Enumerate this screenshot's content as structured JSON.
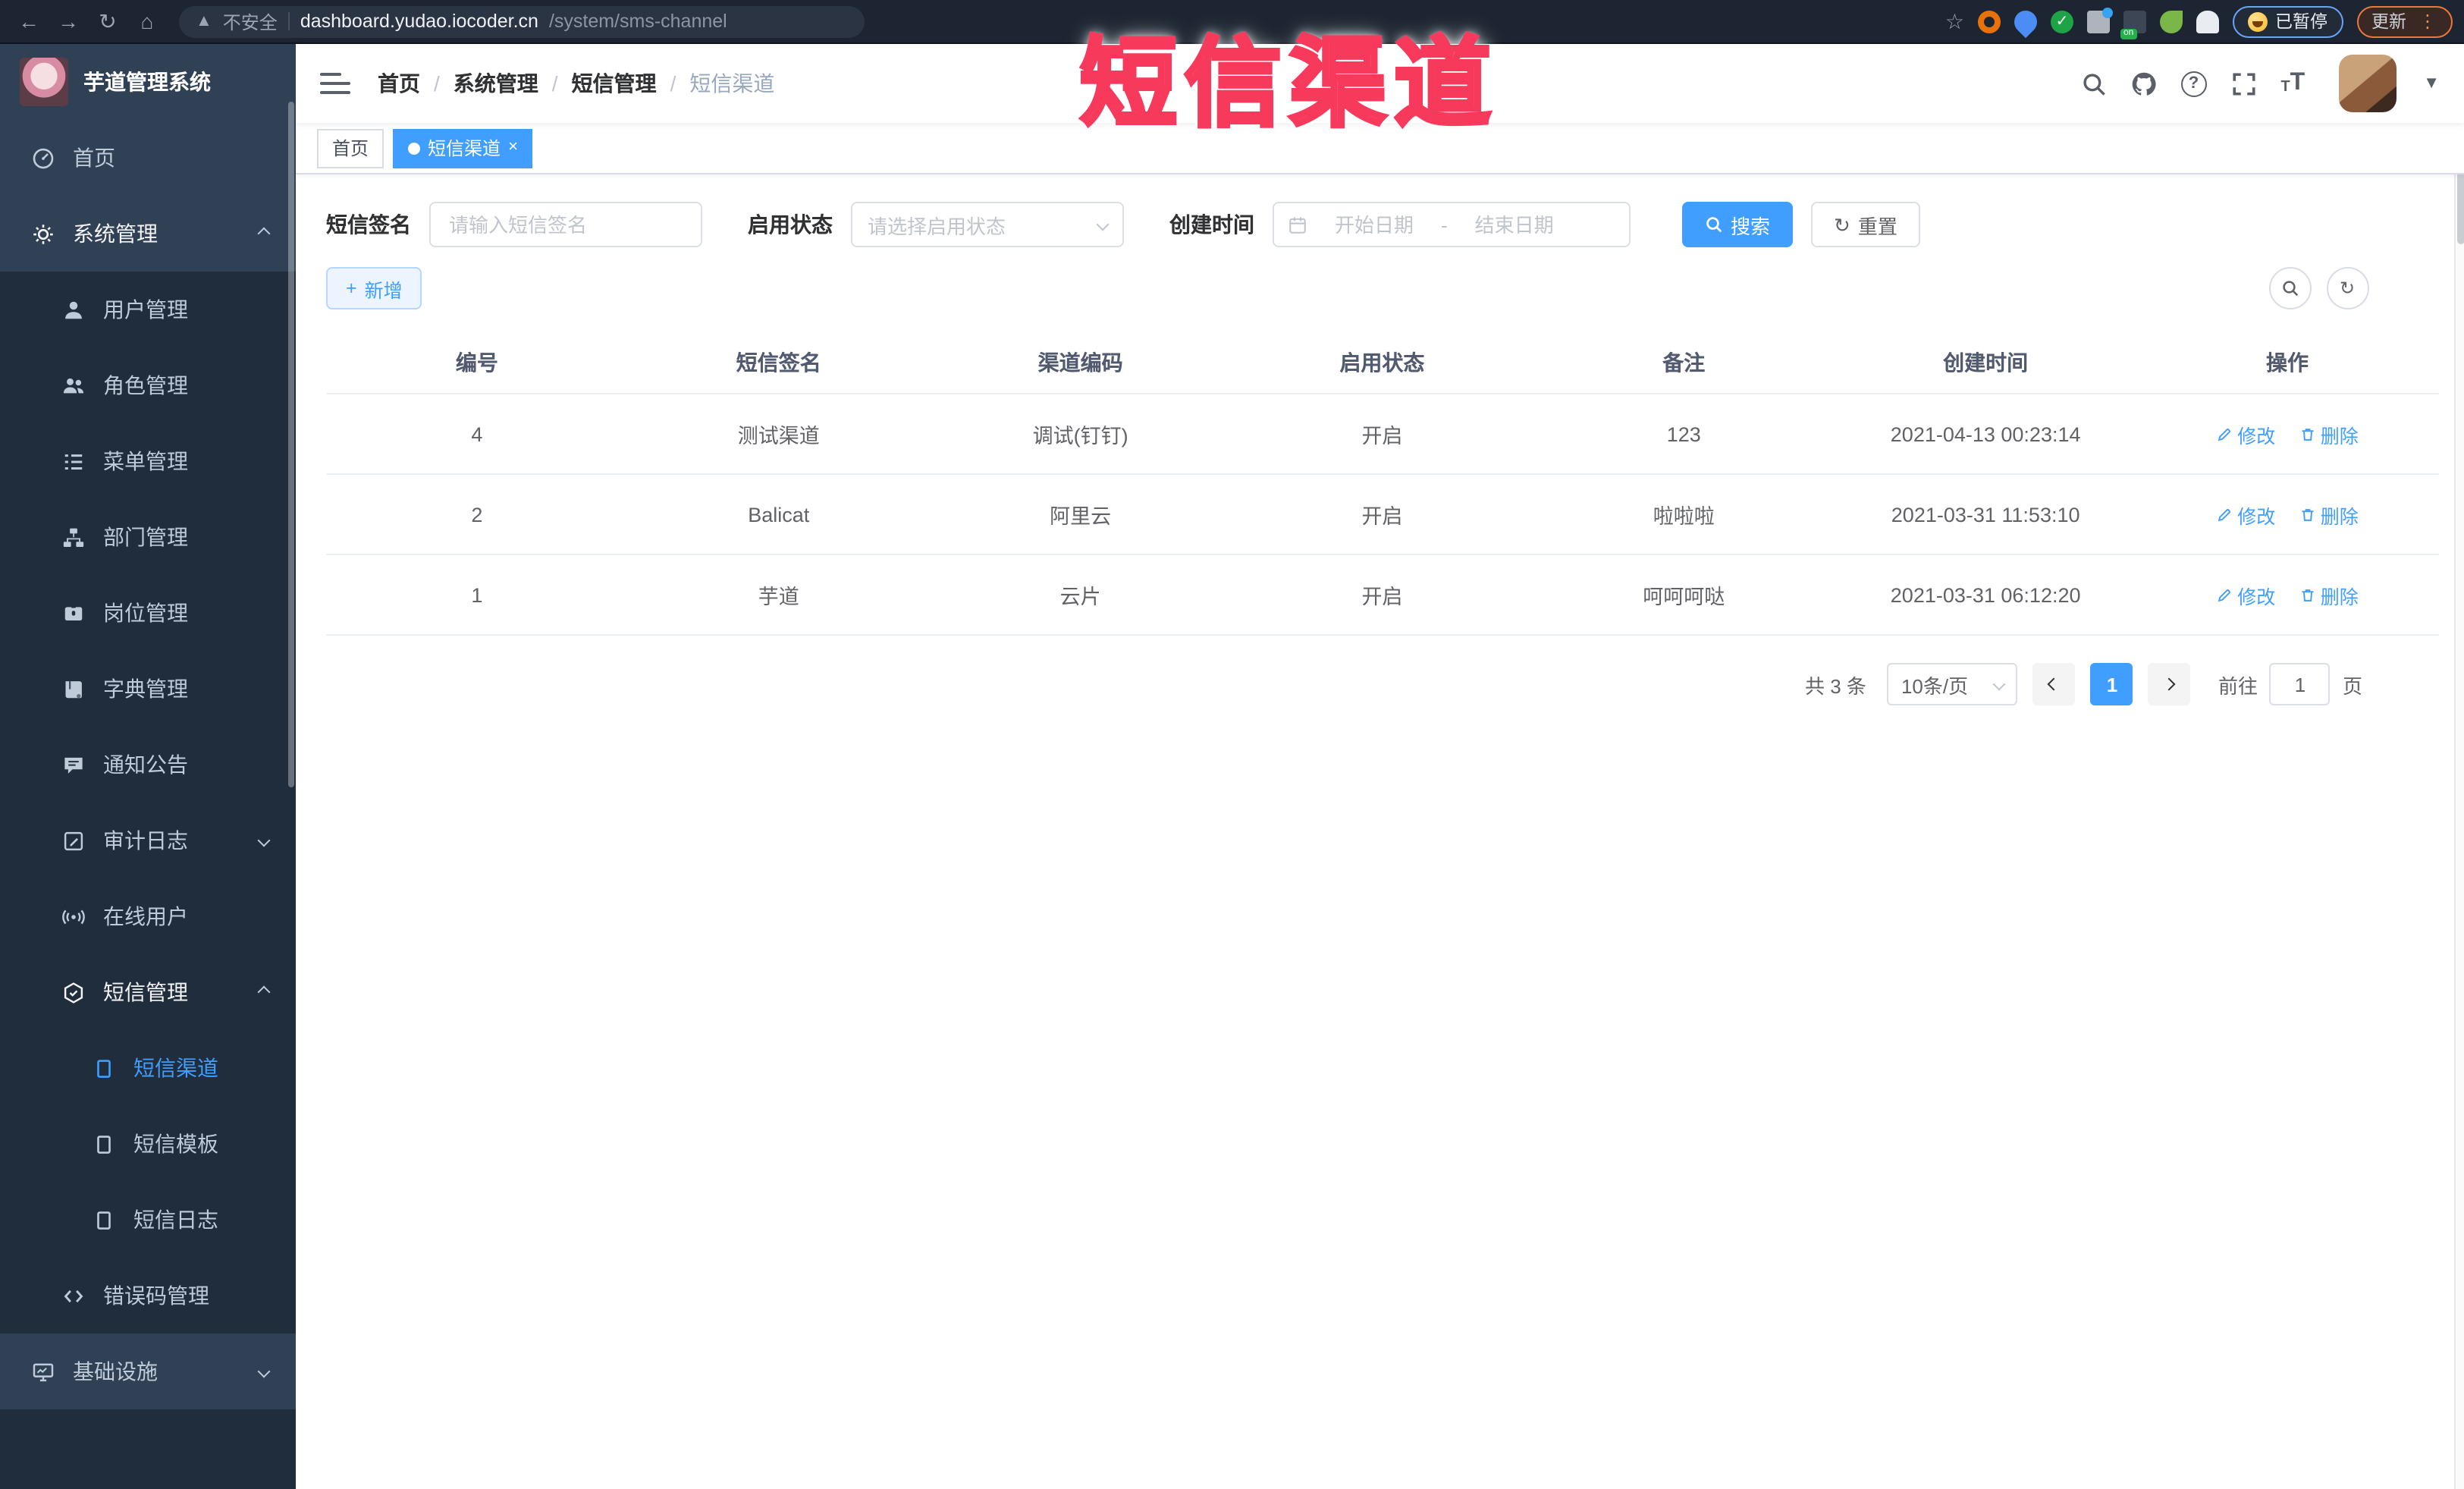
{
  "browser": {
    "security_label": "不安全",
    "url_host": "dashboard.yudao.iocoder.cn",
    "url_path": "/system/sms-channel",
    "paused_badge": "已暂停",
    "update_button": "更新"
  },
  "overlay": {
    "title": "短信渠道"
  },
  "sidebar": {
    "app_title": "芋道管理系统",
    "items": [
      {
        "label": "首页"
      },
      {
        "label": "系统管理"
      },
      {
        "label": "用户管理"
      },
      {
        "label": "角色管理"
      },
      {
        "label": "菜单管理"
      },
      {
        "label": "部门管理"
      },
      {
        "label": "岗位管理"
      },
      {
        "label": "字典管理"
      },
      {
        "label": "通知公告"
      },
      {
        "label": "审计日志"
      },
      {
        "label": "在线用户"
      },
      {
        "label": "短信管理"
      },
      {
        "label": "短信渠道"
      },
      {
        "label": "短信模板"
      },
      {
        "label": "短信日志"
      },
      {
        "label": "错误码管理"
      },
      {
        "label": "基础设施"
      }
    ]
  },
  "header": {
    "breadcrumb": [
      "首页",
      "系统管理",
      "短信管理",
      "短信渠道"
    ],
    "sep": "/"
  },
  "tags": {
    "home": "首页",
    "active": "短信渠道",
    "close": "×"
  },
  "search": {
    "sign_label": "短信签名",
    "sign_placeholder": "请输入短信签名",
    "status_label": "启用状态",
    "status_placeholder": "请选择启用状态",
    "time_label": "创建时间",
    "start_placeholder": "开始日期",
    "range_sep": "-",
    "end_placeholder": "结束日期",
    "search_button": "搜索",
    "reset_button": "重置"
  },
  "toolbar": {
    "add_button": "新增"
  },
  "table": {
    "headers": [
      "编号",
      "短信签名",
      "渠道编码",
      "启用状态",
      "备注",
      "创建时间",
      "操作"
    ],
    "action_edit": "修改",
    "action_delete": "删除",
    "rows": [
      {
        "id": "4",
        "sign": "测试渠道",
        "code": "调试(钉钉)",
        "status": "开启",
        "remark": "123",
        "time": "2021-04-13 00:23:14"
      },
      {
        "id": "2",
        "sign": "Balicat",
        "code": "阿里云",
        "status": "开启",
        "remark": "啦啦啦",
        "time": "2021-03-31 11:53:10"
      },
      {
        "id": "1",
        "sign": "芋道",
        "code": "云片",
        "status": "开启",
        "remark": "呵呵呵哒",
        "time": "2021-03-31 06:12:20"
      }
    ]
  },
  "pagination": {
    "total": "共 3 条",
    "page_size": "10条/页",
    "current": "1",
    "goto_label": "前往",
    "goto_value": "1",
    "page_label": "页"
  },
  "colors": {
    "primary": "#409EFF",
    "sidebar_bg": "#304156",
    "submenu_bg": "#1f2d3d",
    "annotation": "#f73a5c"
  }
}
